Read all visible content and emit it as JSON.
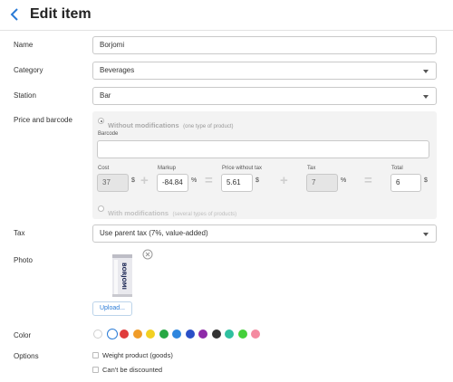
{
  "header": {
    "title": "Edit item",
    "back_icon": "chevron-left-icon"
  },
  "name": {
    "label": "Name",
    "value": "Borjomi"
  },
  "category": {
    "label": "Category",
    "value": "Beverages"
  },
  "station": {
    "label": "Station",
    "value": "Bar"
  },
  "price": {
    "label": "Price and barcode",
    "without_mod": "Without modifications",
    "without_mod_hint": "(one type of product)",
    "barcode_label": "Barcode",
    "barcode_value": "",
    "cost_label": "Cost",
    "cost_value": "37",
    "cost_unit": "$",
    "markup_label": "Markup",
    "markup_value": "-84.84",
    "markup_unit": "%",
    "pwt_label": "Price without tax",
    "pwt_value": "5.61",
    "pwt_unit": "$",
    "tax_label": "Tax",
    "tax_value": "7",
    "tax_unit": "%",
    "total_label": "Total",
    "total_value": "6",
    "total_unit": "$",
    "plus": "+",
    "equals": "=",
    "with_mod": "With modifications",
    "with_mod_hint": "(several types of products)"
  },
  "tax": {
    "label": "Tax",
    "value": "Use parent tax (7%, value-added)"
  },
  "photo": {
    "label": "Photo",
    "upload_label": "Upload...",
    "can_text": "BORJOMI"
  },
  "color": {
    "label": "Color",
    "swatches": [
      "#ffffff",
      "#ffffff",
      "#e03c3c",
      "#f09c28",
      "#f2d022",
      "#27a844",
      "#2e86de",
      "#2a4fc7",
      "#8e2aa8",
      "#333333",
      "#2fc0a0",
      "#44d03a",
      "#f48aa0"
    ],
    "selected_index": 1
  },
  "options": {
    "label": "Options",
    "weight": "Weight product (goods)",
    "no_discount": "Can't be discounted"
  }
}
